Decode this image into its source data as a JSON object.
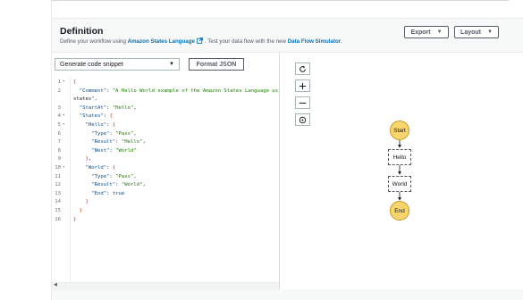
{
  "definition": {
    "title": "Definition",
    "desc_prefix": "Define your workflow using ",
    "asl_link": "Amazon States Language",
    "desc_middle": ". Test your data flow with the new ",
    "simulator_link": "Data Flow Simulator",
    "desc_suffix": "."
  },
  "header_buttons": {
    "export_label": "Export",
    "layout_label": "Layout"
  },
  "toolbar": {
    "snippet_select_value": "Generate code snippet",
    "format_json_label": "Format JSON"
  },
  "code": {
    "lines": [
      {
        "n": "1",
        "fold": true
      },
      {
        "n": "2",
        "fold": false
      },
      {
        "n": "",
        "fold": false
      },
      {
        "n": "3",
        "fold": false
      },
      {
        "n": "4",
        "fold": true
      },
      {
        "n": "5",
        "fold": true
      },
      {
        "n": "6",
        "fold": false
      },
      {
        "n": "7",
        "fold": false
      },
      {
        "n": "8",
        "fold": false
      },
      {
        "n": "9",
        "fold": false
      },
      {
        "n": "10",
        "fold": true
      },
      {
        "n": "11",
        "fold": false
      },
      {
        "n": "12",
        "fold": false
      },
      {
        "n": "13",
        "fold": false
      },
      {
        "n": "14",
        "fold": false
      },
      {
        "n": "15",
        "fold": false
      },
      {
        "n": "16",
        "fold": false
      }
    ],
    "text": [
      "{",
      "  \"Comment\": \"A Hello World example of the Amazon States Language using Pa",
      "states\",",
      "  \"StartAt\": \"Hello\",",
      "  \"States\": {",
      "    \"Hello\": {",
      "      \"Type\": \"Pass\",",
      "      \"Result\": \"Hello\",",
      "      \"Next\": \"World\"",
      "    },",
      "    \"World\": {",
      "      \"Type\": \"Pass\",",
      "      \"Result\": \"World\",",
      "      \"End\": true",
      "    }",
      "  }",
      "}"
    ]
  },
  "graph": {
    "nodes": {
      "start": "Start",
      "hello": "Hello",
      "world": "World",
      "end": "End"
    },
    "tools": [
      "refresh-icon",
      "zoom-in-icon",
      "zoom-out-icon",
      "center-icon"
    ]
  },
  "colors": {
    "link": "#0073bb",
    "terminal_node": "#f9d56e",
    "json_key": "#0b4f8b",
    "json_string": "#1d8102",
    "json_brace": "#d13212"
  }
}
